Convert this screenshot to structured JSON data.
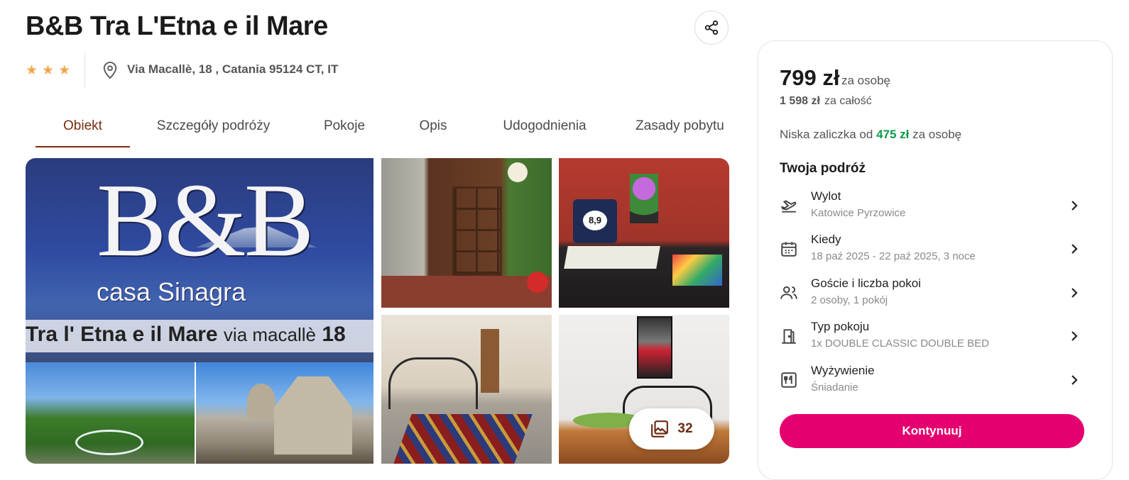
{
  "header": {
    "title": "B&B Tra L'Etna e il Mare",
    "stars": 3,
    "address": "Via Macallè, 18 , Catania 95124 CT, IT",
    "share_icon": "share-icon",
    "location_icon": "map-pin-icon"
  },
  "tabs": [
    {
      "label": "Obiekt",
      "active": true
    },
    {
      "label": "Szczegóły podróży",
      "active": false
    },
    {
      "label": "Pokoje",
      "active": false
    },
    {
      "label": "Opis",
      "active": false
    },
    {
      "label": "Udogodnienia",
      "active": false
    },
    {
      "label": "Zasady pobytu",
      "active": false
    }
  ],
  "gallery": {
    "main_sign": {
      "line1": "B&B",
      "line2": "casa Sinagra",
      "strip_bold": "Tra l' Etna e il Mare",
      "strip_thin": "via macallè",
      "strip_number": "18"
    },
    "desk_badge": "8,9",
    "photo_count": "32",
    "gallery_icon": "photo-gallery-icon"
  },
  "booking": {
    "price": "799 zł",
    "price_suffix": "za osobę",
    "total": "1 598 zł",
    "total_suffix": "za całość",
    "deposit_prefix": "Niska zaliczka od",
    "deposit_amount": "475 zł",
    "deposit_suffix": "za osobę",
    "trip_title": "Twoja podróż",
    "items": [
      {
        "label": "Wylot",
        "value": "Katowice Pyrzowice",
        "icon": "plane-departure-icon"
      },
      {
        "label": "Kiedy",
        "value": "18 paź 2025 - 22 paź 2025, 3 noce",
        "icon": "calendar-icon"
      },
      {
        "label": "Goście i liczba pokoi",
        "value": "2 osoby, 1 pokój",
        "icon": "guests-icon"
      },
      {
        "label": "Typ pokoju",
        "value": "1x DOUBLE CLASSIC DOUBLE BED",
        "icon": "door-icon"
      },
      {
        "label": "Wyżywienie",
        "value": "Śniadanie",
        "icon": "meal-icon"
      }
    ],
    "cta_label": "Kontynuuj"
  },
  "colors": {
    "accent_tab": "#7a2d10",
    "cta": "#e5006f",
    "deposit_green": "#0d9a4a",
    "stars": "#f2a74b"
  }
}
